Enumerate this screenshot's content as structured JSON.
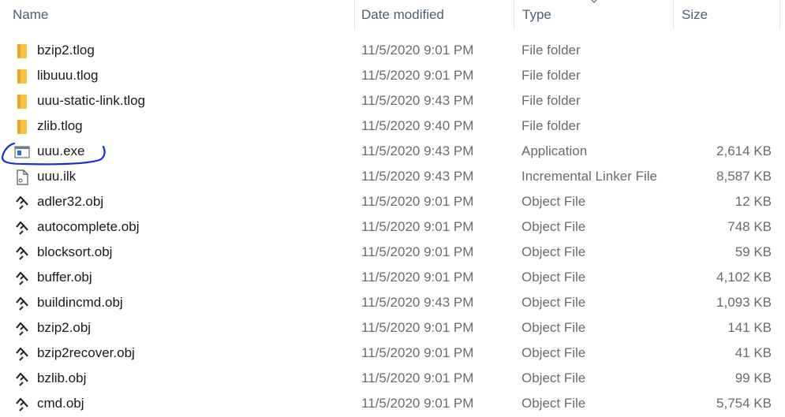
{
  "columns": {
    "name": "Name",
    "date_modified": "Date modified",
    "type": "Type",
    "size": "Size"
  },
  "files": [
    {
      "name": "bzip2.tlog",
      "date": "11/5/2020 9:01 PM",
      "type": "File folder",
      "size": "",
      "icon": "folder-icon"
    },
    {
      "name": "libuuu.tlog",
      "date": "11/5/2020 9:01 PM",
      "type": "File folder",
      "size": "",
      "icon": "folder-icon"
    },
    {
      "name": "uuu-static-link.tlog",
      "date": "11/5/2020 9:43 PM",
      "type": "File folder",
      "size": "",
      "icon": "folder-icon"
    },
    {
      "name": "zlib.tlog",
      "date": "11/5/2020 9:40 PM",
      "type": "File folder",
      "size": "",
      "icon": "folder-icon"
    },
    {
      "name": "uuu.exe",
      "date": "11/5/2020 9:43 PM",
      "type": "Application",
      "size": "2,614 KB",
      "icon": "application-icon"
    },
    {
      "name": "uuu.ilk",
      "date": "11/5/2020 9:43 PM",
      "type": "Incremental Linker File",
      "size": "8,587 KB",
      "icon": "file-icon"
    },
    {
      "name": "adler32.obj",
      "date": "11/5/2020 9:01 PM",
      "type": "Object File",
      "size": "12 KB",
      "icon": "object-file-icon"
    },
    {
      "name": "autocomplete.obj",
      "date": "11/5/2020 9:01 PM",
      "type": "Object File",
      "size": "748 KB",
      "icon": "object-file-icon"
    },
    {
      "name": "blocksort.obj",
      "date": "11/5/2020 9:01 PM",
      "type": "Object File",
      "size": "59 KB",
      "icon": "object-file-icon"
    },
    {
      "name": "buffer.obj",
      "date": "11/5/2020 9:01 PM",
      "type": "Object File",
      "size": "4,102 KB",
      "icon": "object-file-icon"
    },
    {
      "name": "buildincmd.obj",
      "date": "11/5/2020 9:43 PM",
      "type": "Object File",
      "size": "1,093 KB",
      "icon": "object-file-icon"
    },
    {
      "name": "bzip2.obj",
      "date": "11/5/2020 9:01 PM",
      "type": "Object File",
      "size": "141 KB",
      "icon": "object-file-icon"
    },
    {
      "name": "bzip2recover.obj",
      "date": "11/5/2020 9:01 PM",
      "type": "Object File",
      "size": "41 KB",
      "icon": "object-file-icon"
    },
    {
      "name": "bzlib.obj",
      "date": "11/5/2020 9:01 PM",
      "type": "Object File",
      "size": "99 KB",
      "icon": "object-file-icon"
    },
    {
      "name": "cmd.obj",
      "date": "11/5/2020 9:01 PM",
      "type": "Object File",
      "size": "5,754 KB",
      "icon": "object-file-icon"
    }
  ],
  "colors": {
    "header_text": "#4c607a",
    "name_text": "#1a1a1a",
    "detail_text": "#6b6b6b",
    "folder": "#f5c542",
    "annotation": "#1a2fd6"
  }
}
